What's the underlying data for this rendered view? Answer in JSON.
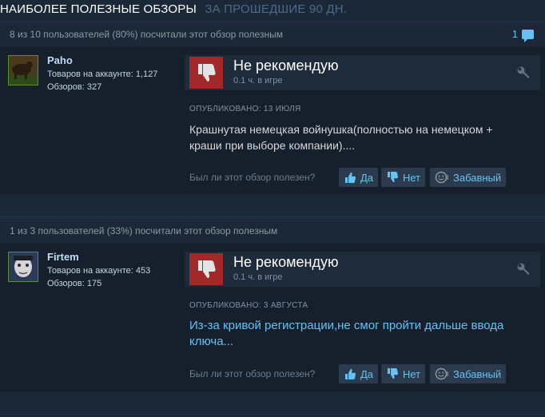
{
  "header": {
    "title": "НАИБОЛЕЕ ПОЛЕЗНЫЕ ОБЗОРЫ",
    "subtitle": "ЗА ПРОШЕДШИЕ 90 ДН."
  },
  "reviews": [
    {
      "helpful_text": "8 из 10 пользователей (80%) посчитали этот обзор полезным",
      "comment_count": "1",
      "reviewer": {
        "name": "Рaho",
        "products": "Товаров на аккаунте: 1,127",
        "reviews": "Обзоров: 327"
      },
      "vote": "Не рекомендую",
      "hours": "0.1 ч. в игре",
      "posted": "ОПУБЛИКОВАНО: 13 ИЮЛЯ",
      "text": "Крашнутая немецкая войнушка(полностью на немецком + краши при выборе компании)....",
      "question": "Был ли этот обзор полезен?",
      "yes": "Да",
      "no": "Нет",
      "funny": "Забавный"
    },
    {
      "helpful_text": "1 из 3 пользователей (33%) посчитали этот обзор полезным",
      "reviewer": {
        "name": "Firtem",
        "products": "Товаров на аккаунте: 453",
        "reviews": "Обзоров: 175"
      },
      "vote": "Не рекомендую",
      "hours": "0.1 ч. в игре",
      "posted": "ОПУБЛИКОВАНО: 3 АВГУСТА",
      "text": "Из-за кривой регистрации,не смог пройти дальше ввода ключа...",
      "question": "Был ли этот обзор полезен?",
      "yes": "Да",
      "no": "Нет",
      "funny": "Забавный"
    }
  ],
  "colors": {
    "background": "#1b2838",
    "thumb_down": "#a3282a",
    "link": "#66c0f4"
  }
}
